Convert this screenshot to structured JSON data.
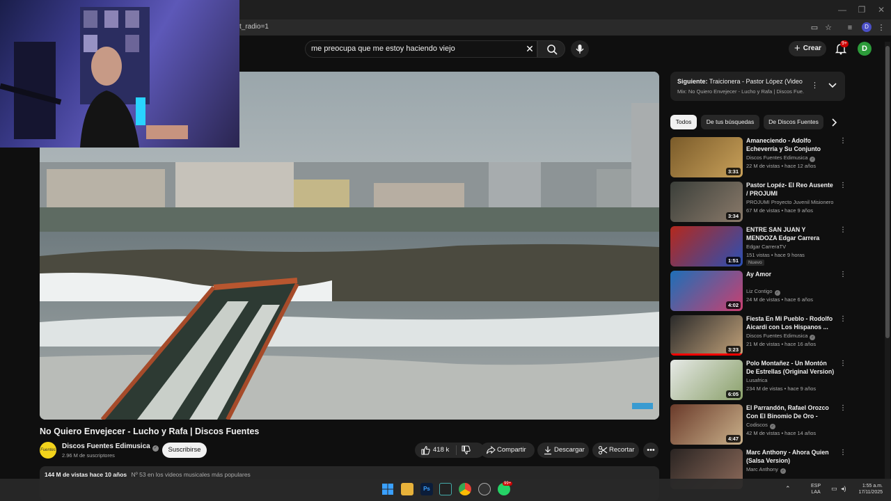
{
  "browser": {
    "url": "t_radio=1",
    "profile_initial": "D"
  },
  "header": {
    "search_value": "me preocupa que me estoy haciendo viejo",
    "create_label": "Crear",
    "notifications_badge": "9+",
    "avatar_initial": "D"
  },
  "video": {
    "title": "No Quiero Envejecer - Lucho y Rafa | Discos Fuentes",
    "channel_name": "Discos Fuentes Edimusica",
    "channel_logo_text": "Fuentes",
    "subscribers": "2.96 M de suscriptores",
    "subscribe_label": "Suscribirse",
    "likes": "418 k",
    "share_label": "Compartir",
    "download_label": "Descargar",
    "clip_label": "Recortar",
    "views_date": "144 M de vistas  hace 10 años",
    "trending": "Nº 53 en los videos musicales más populares"
  },
  "up_next": {
    "label": "Siguiente:",
    "title": "Traicionera - Pastor López (Video ...",
    "mix": "Mix: No Quiero Envejecer - Lucho y Rafa | Discos Fue..."
  },
  "chips": [
    "Todos",
    "De tus búsquedas",
    "De Discos Fuentes"
  ],
  "recommendations": [
    {
      "title": "Amaneciendo - Adolfo Echeverría y Su Conjunto (Vide...",
      "channel": "Discos Fuentes Edimusica",
      "verified": true,
      "meta": "22 M de vistas • hace 12 años",
      "duration": "3:31",
      "badge": "",
      "progress": 0
    },
    {
      "title": "Pastor Lopéz- El Reo Ausente / PROJUMI",
      "channel": "PROJUMI Proyecto Juvenil Misionero",
      "verified": false,
      "meta": "67 M de vistas • hace 9 años",
      "duration": "3:34",
      "badge": "",
      "progress": 0
    },
    {
      "title": "ENTRE SAN JUAN Y MENDOZA Edgar Carrera Noviembre 16 ...",
      "channel": "Edgar CarreraTV",
      "verified": false,
      "meta": "151 vistas • hace 9 horas",
      "duration": "1:51",
      "badge": "Nuevo",
      "progress": 0
    },
    {
      "title": "Ay Amor",
      "channel": "Liz Contigo",
      "verified": true,
      "meta": "24 M de vistas • hace 6 años",
      "duration": "4:02",
      "badge": "",
      "progress": 0
    },
    {
      "title": "Fiesta En Mi Pueblo - Rodolfo Aicardi con Los Hispanos ...",
      "channel": "Discos Fuentes Edimusica",
      "verified": true,
      "meta": "21 M de vistas • hace 16 años",
      "duration": "3:23",
      "badge": "",
      "progress": 1.0
    },
    {
      "title": "Polo Montañez - Un Montón De Estrellas (Original Version)",
      "channel": "Lusafrica",
      "verified": false,
      "meta": "234 M de vistas • hace 9 años",
      "duration": "6:05",
      "badge": "",
      "progress": 0
    },
    {
      "title": "El Parrandón, Rafael Orozco Con El Binomio De Oro - Video...",
      "channel": "Codiscos",
      "verified": true,
      "meta": "42 M de vistas • hace 14 años",
      "duration": "4:47",
      "badge": "",
      "progress": 0
    },
    {
      "title": "Marc Anthony - Ahora Quien (Salsa Version)",
      "channel": "Marc Anthony",
      "verified": true,
      "meta": "",
      "duration": "",
      "badge": "",
      "progress": 0
    }
  ],
  "taskbar": {
    "lang": "ESP",
    "lang_sub": "LAA",
    "time": "1:55 a.m.",
    "date": "17/11/2025",
    "whatsapp_badge": "99+"
  },
  "colors": {
    "background": "#0f0f0f",
    "surface": "#272727",
    "accent_red": "#cc0000",
    "avatar_green": "#2c9b3a"
  }
}
